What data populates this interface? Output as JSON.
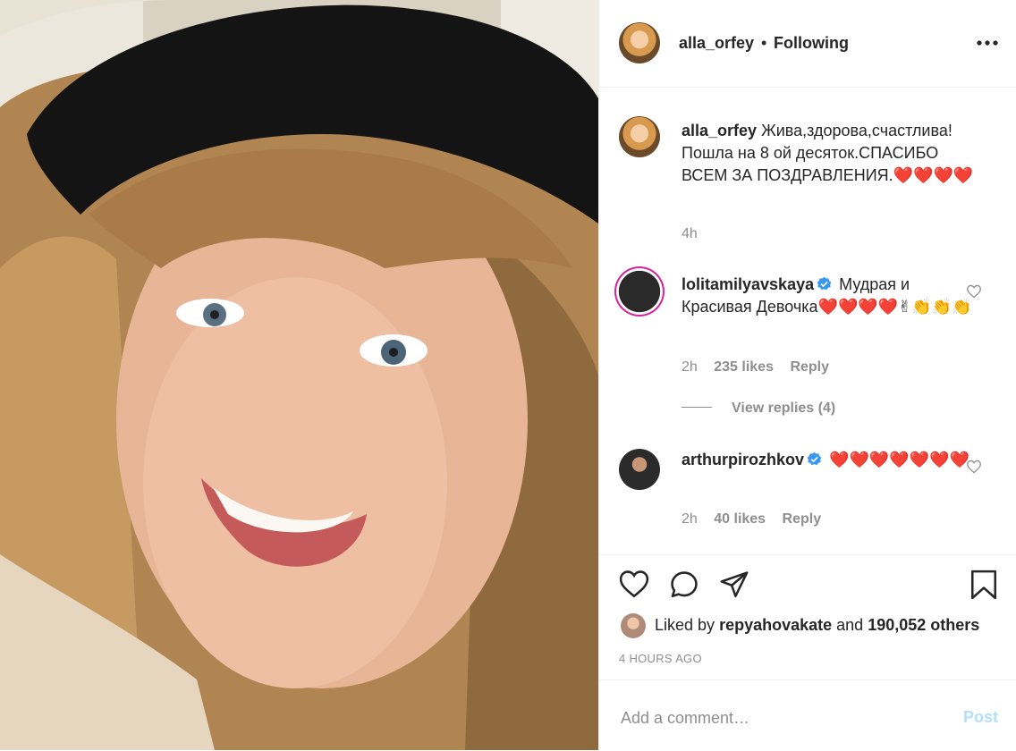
{
  "post": {
    "author": "alla_orfey",
    "separator": "•",
    "follow_state": "Following",
    "caption": "Жива,здорова,счастлива! Пошла на 8 ой десяток.СПАСИБО ВСЕМ ЗА ПОЗДРАВЛЕНИЯ.",
    "caption_emoji": "❤️❤️❤️❤️",
    "caption_time": "4h"
  },
  "comments": [
    {
      "username": "lolitamilyavskaya",
      "verified": true,
      "text": "Мудрая и Красивая Девочка",
      "emoji": "❤️❤️❤️❤️✌👏👏👏",
      "time": "2h",
      "likes": "235 likes",
      "reply": "Reply"
    },
    {
      "username": "arthurpirozhkov",
      "verified": true,
      "text": "",
      "emoji": "❤️❤️❤️❤️❤️❤️❤️",
      "time": "2h",
      "likes": "40 likes",
      "reply": "Reply"
    }
  ],
  "view_replies": "View replies (4)",
  "likes": {
    "prefix": "Liked by",
    "user": "repyahovakate",
    "middle": "and",
    "count": "190,052 others"
  },
  "timestamp": "4 HOURS AGO",
  "add_comment": {
    "placeholder": "Add a comment…",
    "post_label": "Post"
  },
  "icons": {
    "more": "more-dots-icon",
    "like": "heart-icon",
    "comment": "comment-bubble-icon",
    "share": "paper-plane-icon",
    "save": "bookmark-icon"
  },
  "colors": {
    "text": "#262626",
    "muted": "#8e8e8e",
    "verified": "#3897f0",
    "post_disabled": "#b2dffc",
    "heart": "#e0245e"
  }
}
